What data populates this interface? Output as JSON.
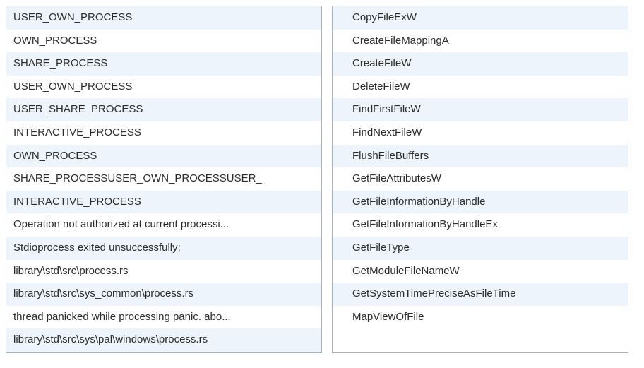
{
  "left": {
    "rows": [
      "USER_OWN_PROCESS",
      "OWN_PROCESS",
      "SHARE_PROCESS",
      "USER_OWN_PROCESS",
      "USER_SHARE_PROCESS",
      "INTERACTIVE_PROCESS",
      "OWN_PROCESS",
      "SHARE_PROCESSUSER_OWN_PROCESSUSER_",
      "INTERACTIVE_PROCESS",
      "Operation not authorized at current processi...",
      "Stdioprocess exited unsuccessfully:",
      "library\\std\\src\\process.rs",
      "library\\std\\src\\sys_common\\process.rs",
      "thread panicked while processing panic. abo...",
      "library\\std\\src\\sys\\pal\\windows\\process.rs"
    ]
  },
  "right": {
    "rows": [
      "CopyFileExW",
      "CreateFileMappingA",
      "CreateFileW",
      "DeleteFileW",
      "FindFirstFileW",
      "FindNextFileW",
      "FlushFileBuffers",
      "GetFileAttributesW",
      "GetFileInformationByHandle",
      "GetFileInformationByHandleEx",
      "GetFileType",
      "GetModuleFileNameW",
      "GetSystemTimePreciseAsFileTime",
      "MapViewOfFile"
    ]
  }
}
